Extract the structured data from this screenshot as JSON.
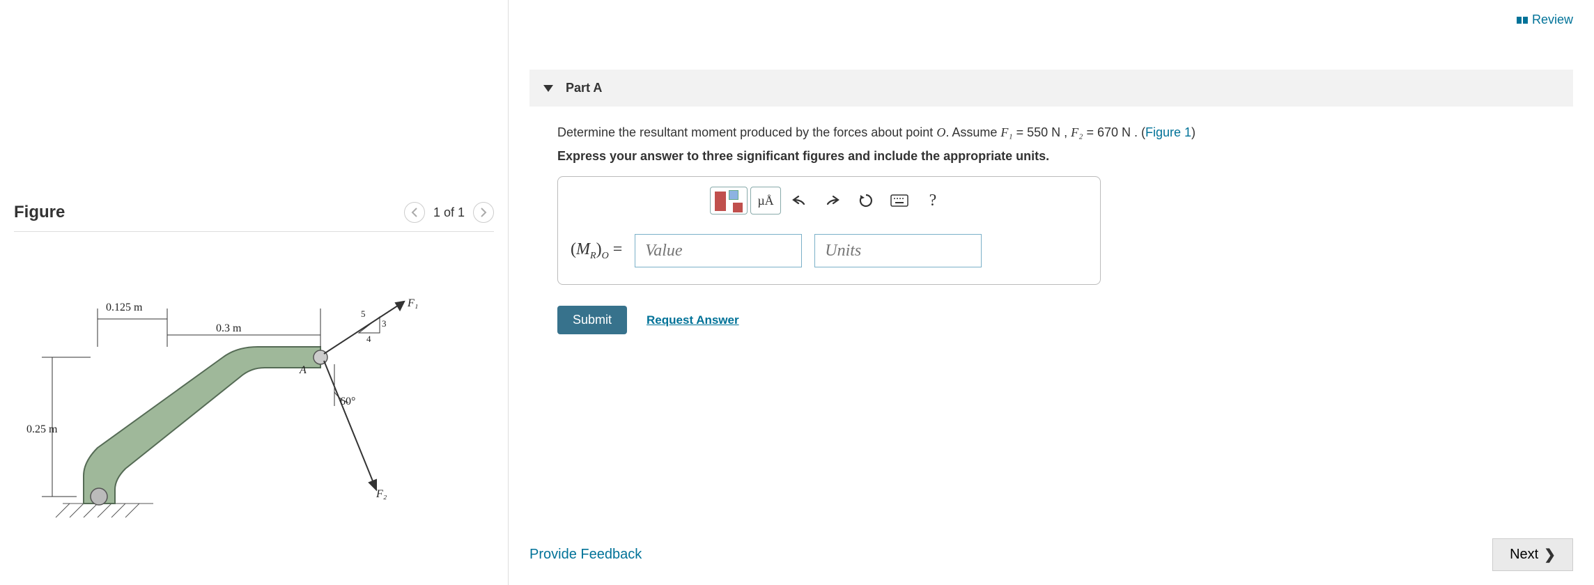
{
  "review": {
    "label": "Review"
  },
  "figure": {
    "title": "Figure",
    "nav_text": "1 of 1",
    "dims": {
      "d1": "0.125 m",
      "d2": "0.3 m",
      "d3": "0.25 m",
      "angle": "60°",
      "ratio_a": "5",
      "ratio_b": "3",
      "ratio_c": "4",
      "F1": "F₁",
      "F2": "F₂",
      "A": "A"
    }
  },
  "part": {
    "title": "Part A",
    "prompt_prefix": "Determine the resultant moment produced by the forces about point ",
    "prompt_o": "O",
    "prompt_assume": ". Assume ",
    "f1_sym": "F₁",
    "f1_val": " = 550 N , ",
    "f2_sym": "F₂",
    "f2_val": " = 670 N . (",
    "figlink": "Figure 1",
    "close": ")",
    "instruction": "Express your answer to three significant figures and include the appropriate units.",
    "mr_label_open": "(",
    "mr_label_m": "M",
    "mr_label_r": "R",
    "mr_label_close": ")",
    "mr_label_o": "O",
    "mr_eq": " =",
    "value_ph": "Value",
    "units_ph": "Units",
    "submit": "Submit",
    "request": "Request Answer"
  },
  "toolbar": {
    "micro": "µÅ",
    "help": "?"
  },
  "feedback": "Provide Feedback",
  "next": "Next"
}
